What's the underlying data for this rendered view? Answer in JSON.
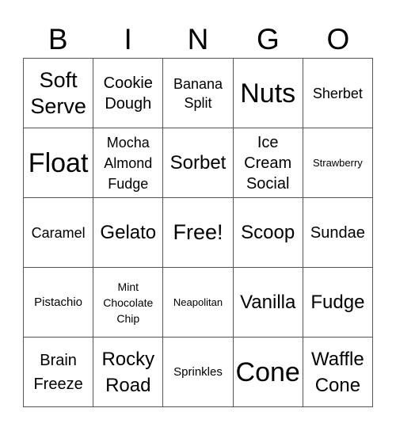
{
  "header": [
    "B",
    "I",
    "N",
    "G",
    "O"
  ],
  "cells": [
    "Soft Serve",
    "Cookie Dough",
    "Banana Split",
    "Nuts",
    "Sherbet",
    "Float",
    "Mocha Almond Fudge",
    "Sorbet",
    "Ice Cream Social",
    "Strawberry",
    "Caramel",
    "Gelato",
    "Free!",
    "Scoop",
    "Sundae",
    "Pistachio",
    "Mint Chocolate Chip",
    "Neapolitan",
    "Vanilla",
    "Fudge",
    "Brain Freeze",
    "Rocky Road",
    "Sprinkles",
    "Cone",
    "Waffle Cone"
  ]
}
